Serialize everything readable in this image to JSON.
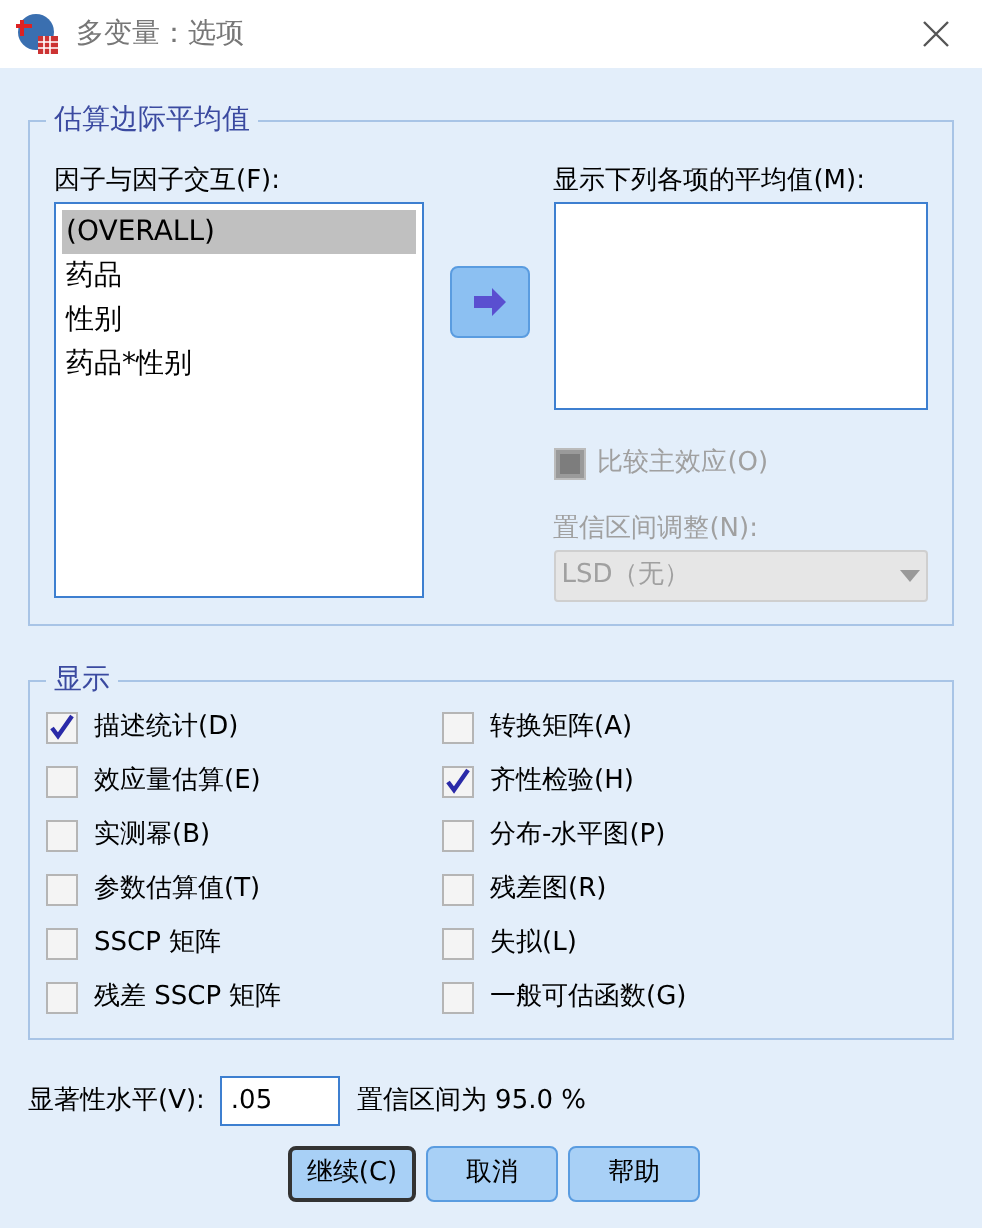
{
  "window": {
    "title": "多变量：选项"
  },
  "marginal_means": {
    "title": "估算边际平均值",
    "factors_label": "因子与因子交互(F):",
    "factors": [
      {
        "label": "(OVERALL)",
        "selected": true
      },
      {
        "label": "药品",
        "selected": false
      },
      {
        "label": "性别",
        "selected": false
      },
      {
        "label": "药品*性别",
        "selected": false
      }
    ],
    "means_label": "显示下列各项的平均值(M):",
    "compare": {
      "label": "比较主效应(O)",
      "checked": false,
      "disabled": true
    },
    "ci_label": "置信区间调整(N):",
    "ci_select": {
      "value": "LSD（无）",
      "disabled": true
    }
  },
  "display": {
    "title": "显示",
    "options": [
      {
        "label": "描述统计(D)",
        "checked": true
      },
      {
        "label": "转换矩阵(A)",
        "checked": false
      },
      {
        "label": "效应量估算(E)",
        "checked": false
      },
      {
        "label": "齐性检验(H)",
        "checked": true
      },
      {
        "label": "实测幂(B)",
        "checked": false
      },
      {
        "label": "分布-水平图(P)",
        "checked": false
      },
      {
        "label": "参数估算值(T)",
        "checked": false
      },
      {
        "label": "残差图(R)",
        "checked": false
      },
      {
        "label": "SSCP 矩阵",
        "checked": false
      },
      {
        "label": "失拟(L)",
        "checked": false
      },
      {
        "label": "残差 SSCP 矩阵",
        "checked": false
      },
      {
        "label": "一般可估函数(G)",
        "checked": false
      }
    ]
  },
  "significance": {
    "label": "显著性水平(V):",
    "value": ".05",
    "ci_text": "置信区间为 95.0 %"
  },
  "buttons": [
    {
      "label": "继续(C)",
      "default": true
    },
    {
      "label": "取消",
      "default": false
    },
    {
      "label": "帮助",
      "default": false
    }
  ]
}
